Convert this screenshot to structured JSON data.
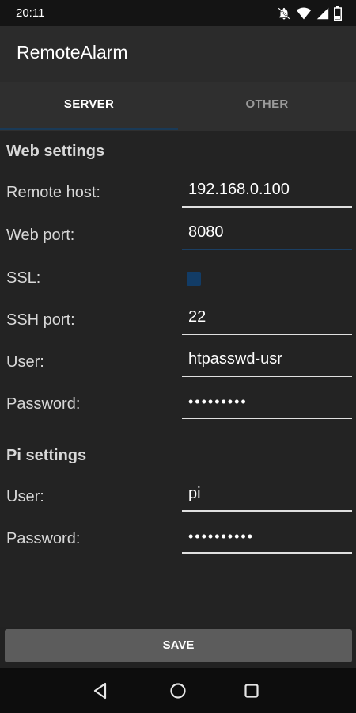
{
  "status": {
    "time": "20:11"
  },
  "app": {
    "title": "RemoteAlarm"
  },
  "tabs": [
    {
      "label": "SERVER",
      "selected": true
    },
    {
      "label": "OTHER",
      "selected": false
    }
  ],
  "web_settings": {
    "title": "Web settings",
    "remote_host_label": "Remote host:",
    "remote_host_value": "192.168.0.100",
    "web_port_label": "Web port:",
    "web_port_value": "8080",
    "ssl_label": "SSL:",
    "ssl_checked": false,
    "ssh_port_label": "SSH port:",
    "ssh_port_value": "22",
    "user_label": "User:",
    "user_value": "htpasswd-usr",
    "password_label": "Password:",
    "password_value": "•••••••••"
  },
  "pi_settings": {
    "title": "Pi settings",
    "user_label": "User:",
    "user_value": "pi",
    "password_label": "Password:",
    "password_value": "••••••••••"
  },
  "actions": {
    "save_label": "SAVE"
  },
  "colors": {
    "accent": "#1a3a57",
    "checkbox": "#123c66",
    "background": "#232323"
  }
}
